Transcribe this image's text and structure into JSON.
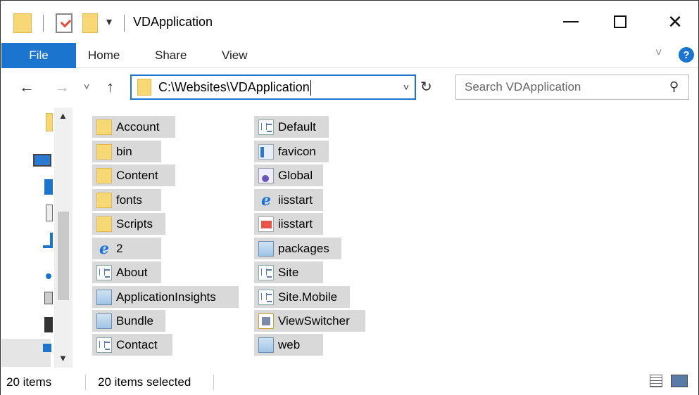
{
  "window": {
    "title": "VDApplication",
    "quick_access_dropdown": "▾",
    "minimize_glyph": "",
    "close_glyph": "✕"
  },
  "ribbon": {
    "tabs": [
      {
        "label": "File"
      },
      {
        "label": "Home"
      },
      {
        "label": "Share"
      },
      {
        "label": "View"
      }
    ],
    "help_glyph": "?"
  },
  "nav": {
    "back_glyph": "←",
    "forward_glyph": "→",
    "recent_glyph": "˅",
    "up_glyph": "↑",
    "address": "C:\\Websites\\VDApplication",
    "address_dropdown": "˅",
    "refresh_glyph": "↻",
    "search_placeholder": "Search VDApplication",
    "search_glyph": "⚲"
  },
  "items": [
    {
      "label": "Account",
      "icon": "folder-icon"
    },
    {
      "label": "bin",
      "icon": "folder-icon"
    },
    {
      "label": "Content",
      "icon": "folder-icon"
    },
    {
      "label": "fonts",
      "icon": "folder-icon"
    },
    {
      "label": "Scripts",
      "icon": "folder-icon"
    },
    {
      "label": "2",
      "icon": "internet-explorer-icon"
    },
    {
      "label": "About",
      "icon": "aspx-page-icon"
    },
    {
      "label": "ApplicationInsights",
      "icon": "config-file-icon"
    },
    {
      "label": "Bundle",
      "icon": "config-file-icon"
    },
    {
      "label": "Contact",
      "icon": "aspx-page-icon"
    },
    {
      "label": "Default",
      "icon": "aspx-page-icon"
    },
    {
      "label": "favicon",
      "icon": "favicon-icon"
    },
    {
      "label": "Global",
      "icon": "global-asax-icon"
    },
    {
      "label": "iisstart",
      "icon": "internet-explorer-icon"
    },
    {
      "label": "iisstart",
      "icon": "image-file-icon"
    },
    {
      "label": "packages",
      "icon": "config-file-icon"
    },
    {
      "label": "Site",
      "icon": "aspx-page-icon"
    },
    {
      "label": "Site.Mobile",
      "icon": "aspx-page-icon"
    },
    {
      "label": "ViewSwitcher",
      "icon": "user-control-icon"
    },
    {
      "label": "web",
      "icon": "config-file-icon"
    }
  ],
  "status": {
    "item_count": "20 items",
    "selected_count": "20 items selected"
  },
  "colors": {
    "accent": "#1b75cf",
    "selection": "#d9d9d9",
    "folder": "#f8d775"
  }
}
